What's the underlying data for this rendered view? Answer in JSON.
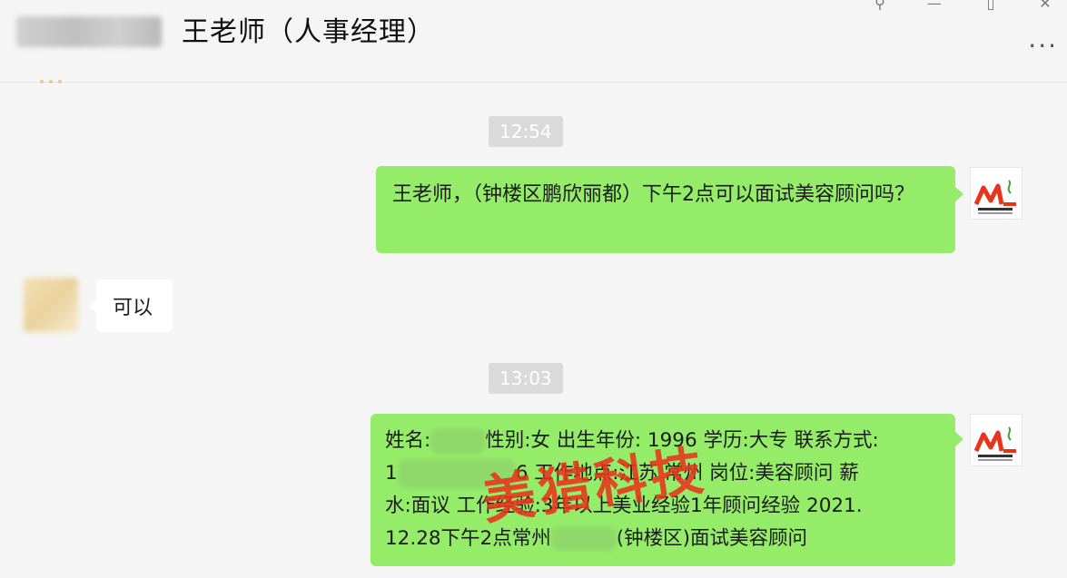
{
  "header": {
    "title": "王老师（人事经理）",
    "more_label": "···"
  },
  "window_controls": {
    "pin": "⚲",
    "minimize": "—",
    "maximize": "▯",
    "close": "✕"
  },
  "messages": [
    {
      "type": "time",
      "text": "12:54"
    },
    {
      "type": "sent",
      "text": "王老师，（钟楼区鹏欣丽都）下午2点可以面试美容顾问吗？"
    },
    {
      "type": "received",
      "text": "可以"
    },
    {
      "type": "time",
      "text": "13:03"
    },
    {
      "type": "sent",
      "lines": [
        {
          "a": "姓名:",
          "b": "性别:女 出生年份: 1996 学历:大专 联系方式:"
        },
        {
          "a": "1",
          "b": "6 工作地点:江苏 常州 岗位:美容顾问 薪"
        },
        {
          "a": "水:面议 工作经验:3年以上美业经验1年顾问经验 2021.",
          "b": ""
        },
        {
          "a": "12.28下午2点常州",
          "b": "(钟楼区)面试美容顾问"
        }
      ]
    }
  ],
  "watermark": "美猎科技",
  "colors": {
    "sent_bubble": "#95ec69",
    "received_bubble": "#ffffff",
    "background": "#f5f5f5",
    "time_badge": "#dadada",
    "logo_red": "#e8341c",
    "logo_green": "#3aa34a"
  },
  "icons": {
    "avatar_logo": "ml-logo-icon",
    "more": "more-icon"
  }
}
